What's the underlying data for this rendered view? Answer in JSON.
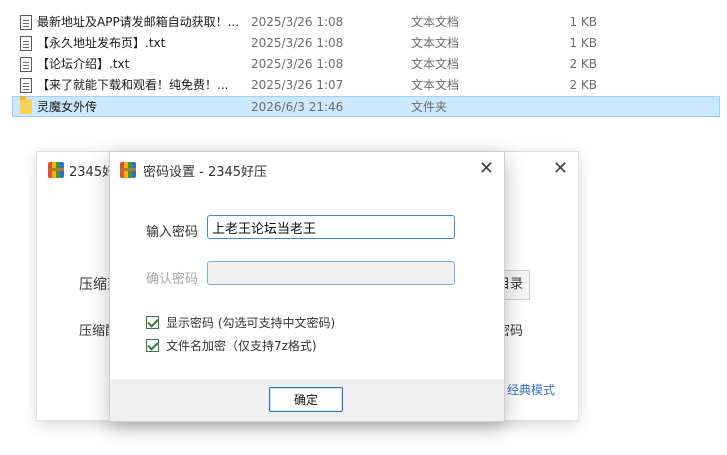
{
  "files": [
    {
      "name": "最新地址及APP请发邮箱自动获取！...",
      "date": "2025/3/26 1:08",
      "type": "文本文档",
      "size": "1 KB",
      "icon": "text-file-icon"
    },
    {
      "name": "【永久地址发布页】.txt",
      "date": "2025/3/26 1:08",
      "type": "文本文档",
      "size": "1 KB",
      "icon": "text-file-icon"
    },
    {
      "name": "【论坛介绍】.txt",
      "date": "2025/3/26 1:08",
      "type": "文本文档",
      "size": "2 KB",
      "icon": "text-file-icon"
    },
    {
      "name": "【来了就能下载和观看！纯免费！...",
      "date": "2025/3/26 1:07",
      "type": "文本文档",
      "size": "2 KB",
      "icon": "text-file-icon"
    },
    {
      "name": "灵魔女外传",
      "date": "2026/6/3 21:46",
      "type": "文件夹",
      "size": "",
      "icon": "folder-icon"
    }
  ],
  "bg_window": {
    "title": "2345好压",
    "label_compress": "压缩到",
    "label_compress2": "压缩配置",
    "browse_label": "浏览目录",
    "right_text": "密码",
    "classic_link": "经典模式"
  },
  "dialog": {
    "title": "密码设置 - 2345好压",
    "password_label": "输入密码",
    "password_value": "上老王论坛当老王",
    "confirm_label": "确认密码",
    "confirm_value": "",
    "show_password_label": "显示密码 (勾选可支持中文密码)",
    "show_password_checked": true,
    "encrypt_names_label": "文件名加密（仅支持7z格式)",
    "encrypt_names_checked": true,
    "ok_label": "确定"
  },
  "colors": {
    "selection_bg": "#cce8ff",
    "accent_border": "#3c8fd0",
    "link": "#3a6fc4"
  }
}
